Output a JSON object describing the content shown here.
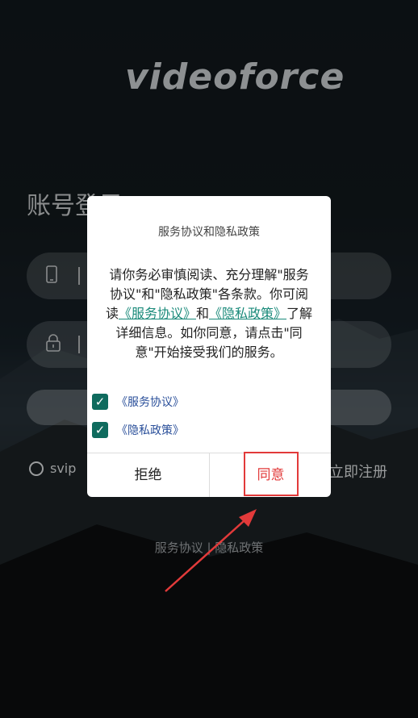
{
  "app": {
    "logo_text": "videoforce"
  },
  "login": {
    "title": "账号登录",
    "phone_icon": "phone-icon",
    "lock_icon": "lock-icon",
    "svip_label": "svip",
    "register_label": "立即注册",
    "footer_links": "服务协议 | 隐私政策"
  },
  "dialog": {
    "title": "服务协议和隐私政策",
    "body_part1": "请你务必审慎阅读、充分理解\"服务协议\"和\"隐私政策\"各条款。你可阅读",
    "link_service": "《服务协议》",
    "body_and": "和",
    "link_privacy": "《隐私政策》",
    "body_part2": "了解详细信息。如你同意，请点击\"同意\"开始接受我们的服务。",
    "checkbox_service_label": "《服务协议》",
    "checkbox_service_checked": true,
    "checkbox_privacy_label": "《隐私政策》",
    "checkbox_privacy_checked": true,
    "reject_label": "拒绝",
    "agree_label": "同意"
  },
  "colors": {
    "accent": "#0f6b5e",
    "link": "#1a8a7a",
    "highlight": "#e23a3a"
  }
}
